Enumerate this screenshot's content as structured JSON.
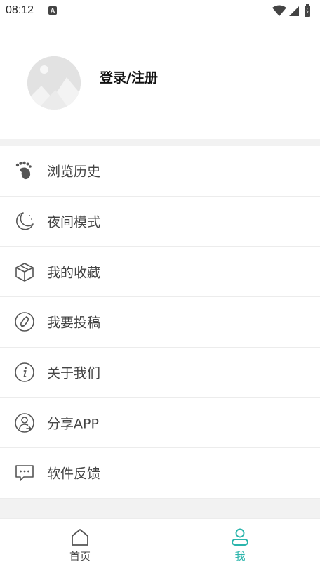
{
  "status_bar": {
    "time": "08:12",
    "notification_letter": "A"
  },
  "profile": {
    "login_label": "登录/注册"
  },
  "menu": {
    "items": [
      {
        "label": "浏览历史",
        "icon": "footprint-icon"
      },
      {
        "label": "夜间模式",
        "icon": "moon-icon"
      },
      {
        "label": "我的收藏",
        "icon": "box-icon"
      },
      {
        "label": "我要投稿",
        "icon": "link-icon"
      },
      {
        "label": "关于我们",
        "icon": "info-icon"
      },
      {
        "label": "分享APP",
        "icon": "share-icon"
      },
      {
        "label": "软件反馈",
        "icon": "chat-icon"
      }
    ]
  },
  "tabbar": {
    "home_label": "首页",
    "me_label": "我"
  },
  "colors": {
    "accent": "#2bb5ac",
    "icon": "#555555",
    "divider": "#f2f2f2"
  }
}
